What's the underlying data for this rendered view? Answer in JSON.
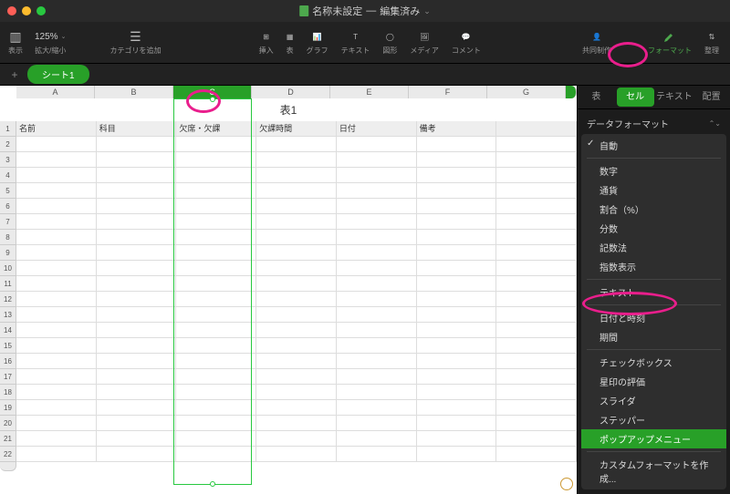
{
  "window": {
    "doc_title": "名称未設定",
    "edited": "編集済み"
  },
  "toolbar": {
    "view_label": "表示",
    "zoom_label": "拡大/縮小",
    "zoom_value": "125%",
    "category_label": "カテゴリを追加",
    "insert_label": "挿入",
    "table_label": "表",
    "graph_label": "グラフ",
    "text_label": "テキスト",
    "shape_label": "図形",
    "media_label": "メディア",
    "comment_label": "コメント",
    "collab_label": "共同制作",
    "format_label": "フォーマット",
    "organize_label": "整理"
  },
  "sheet": {
    "tab1": "シート1",
    "table_title": "表1"
  },
  "columns": [
    "A",
    "B",
    "C",
    "D",
    "E",
    "F",
    "G"
  ],
  "headers": {
    "c1": "名前",
    "c2": "科目",
    "c3": "欠席・欠課",
    "c4": "欠課時間",
    "c5": "日付",
    "c6": "備考",
    "c7": ""
  },
  "selected_column_index": 2,
  "row_count": 22,
  "sidebar": {
    "tabs": {
      "table": "表",
      "cell": "セル",
      "text": "テキスト",
      "align": "配置"
    },
    "section_label": "データフォーマット",
    "items": {
      "auto": "自動",
      "number": "数字",
      "currency": "通貨",
      "percent": "割合（%）",
      "fraction": "分数",
      "scientific": "記数法",
      "exponent": "指数表示",
      "text": "テキスト",
      "datetime": "日付と時刻",
      "duration": "期間",
      "checkbox": "チェックボックス",
      "star": "星印の評価",
      "slider": "スライダ",
      "stepper": "ステッパー",
      "popup": "ポップアップメニュー",
      "custom": "カスタムフォーマットを作成..."
    }
  }
}
